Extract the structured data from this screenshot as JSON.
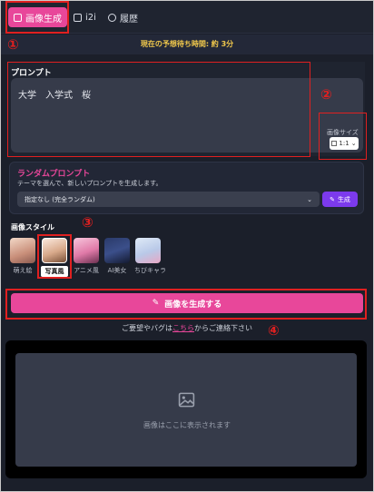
{
  "tabs": [
    {
      "label": "画像生成",
      "icon": "image-icon",
      "active": true
    },
    {
      "label": "i2i",
      "icon": "image-icon",
      "active": false
    },
    {
      "label": "履歴",
      "icon": "history-icon",
      "active": false
    }
  ],
  "wait_banner": "現在の予想待ち時間: 約 3分",
  "prompt": {
    "label": "プロンプト",
    "value": "大学　入学式　桜"
  },
  "image_size": {
    "label": "画像サイズ",
    "value": "1:1"
  },
  "random_prompt": {
    "title": "ランダムプロンプト",
    "description": "テーマを選んで、新しいプロンプトを生成します。",
    "select_value": "指定なし (完全ランダム)",
    "generate_label": "生成"
  },
  "image_style": {
    "label": "画像スタイル",
    "items": [
      {
        "name": "萌え絵",
        "selected": false
      },
      {
        "name": "写真風",
        "selected": true
      },
      {
        "name": "アニメ風",
        "selected": false
      },
      {
        "name": "AI美女",
        "selected": false
      },
      {
        "name": "ちびキャラ",
        "selected": false
      }
    ]
  },
  "generate_button": "画像を生成する",
  "contact": {
    "before": "ご要望やバグは",
    "link": "こちら",
    "after": "からご連絡下さい"
  },
  "result_placeholder": "画像はここに表示されます",
  "annotations": [
    "①",
    "②",
    "③",
    "④"
  ],
  "colors": {
    "accent": "#e8479a",
    "annotation": "#e02020",
    "purple": "#7c3aed",
    "wait_text": "#f2c94c"
  }
}
